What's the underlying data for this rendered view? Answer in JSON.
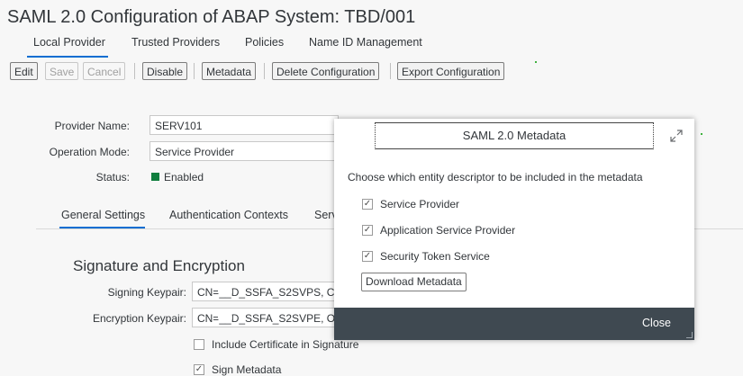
{
  "title": "SAML 2.0 Configuration of ABAP System: TBD/001",
  "tabs": [
    "Local Provider",
    "Trusted Providers",
    "Policies",
    "Name ID Management"
  ],
  "toolbar": {
    "edit": "Edit",
    "save": "Save",
    "cancel": "Cancel",
    "disable": "Disable",
    "metadata": "Metadata",
    "delete": "Delete Configuration",
    "export": "Export Configuration"
  },
  "form": {
    "provider_name_label": "Provider Name:",
    "provider_name_value": "SERV101",
    "operation_mode_label": "Operation Mode:",
    "operation_mode_value": "Service Provider",
    "status_label": "Status:",
    "status_value": "Enabled",
    "status_color": "#107e3e"
  },
  "subtabs": [
    "General Settings",
    "Authentication Contexts",
    "Serv"
  ],
  "signature": {
    "section_title": "Signature and Encryption",
    "signing_label": "Signing Keypair:",
    "signing_value": "CN=__D_SSFA_S2SVPS, C",
    "encryption_label": "Encryption Keypair:",
    "encryption_value": "CN=__D_SSFA_S2SVPE, O",
    "include_cert_label": "Include Certificate in Signature",
    "include_cert_checked": false,
    "sign_metadata_label": "Sign Metadata",
    "sign_metadata_checked": true
  },
  "modal": {
    "title": "SAML 2.0 Metadata",
    "description": "Choose which entity descriptor to be included in the metadata",
    "options": [
      {
        "label": "Service Provider",
        "checked": true
      },
      {
        "label": "Application Service Provider",
        "checked": true
      },
      {
        "label": "Security Token Service",
        "checked": true
      }
    ],
    "download_label": "Download Metadata",
    "close_label": "Close",
    "expand_icon": "expand-icon"
  },
  "colors": {
    "accent": "#0a6ed1",
    "footer": "#3f4951",
    "enabled": "#107e3e"
  }
}
